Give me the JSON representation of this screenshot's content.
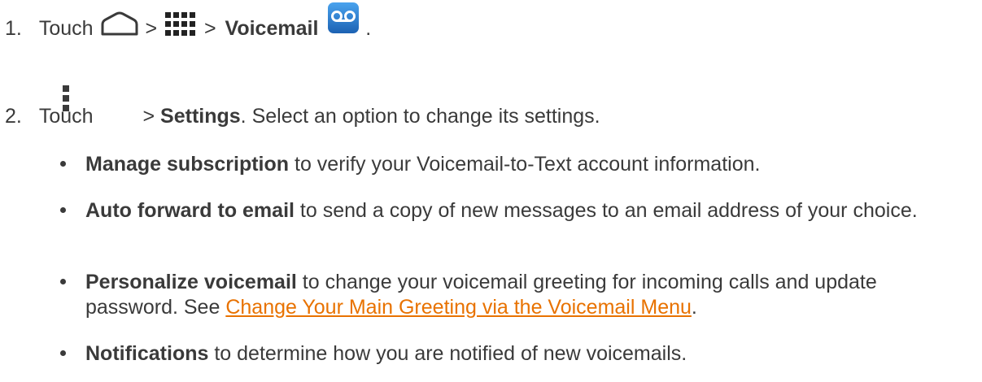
{
  "step1": {
    "number": "1.",
    "prefix": "Touch",
    "sep1": ">",
    "sep2": ">",
    "app": "Voicemail",
    "end": ".",
    "icons": [
      "home-icon",
      "apps-grid-icon",
      "voicemail-app-icon"
    ]
  },
  "step2": {
    "number": "2.",
    "prefix": "Touch",
    "sep": ">",
    "menu": "Settings",
    "rest": ". Select an option to change its settings.",
    "icons": [
      "menu-icon"
    ]
  },
  "bullets": [
    {
      "bold": "Manage subscription",
      "text": " to verify your Voicemail-to-Text account information."
    },
    {
      "bold": "Auto forward to email",
      "text": " to send a copy of new messages to an email address of your choice."
    },
    {
      "bold": "Personalize voicemail",
      "text": " to change your voicemail greeting for incoming calls and update password. See ",
      "link": "Change Your Main Greeting via the Voicemail Menu",
      "after": "."
    },
    {
      "bold": "Notifications",
      "text": " to determine how you are notified of new voicemails."
    }
  ],
  "colors": {
    "text": "#3a3a3a",
    "link": "#e87200",
    "voicemail_icon": "#2d7fd3"
  }
}
